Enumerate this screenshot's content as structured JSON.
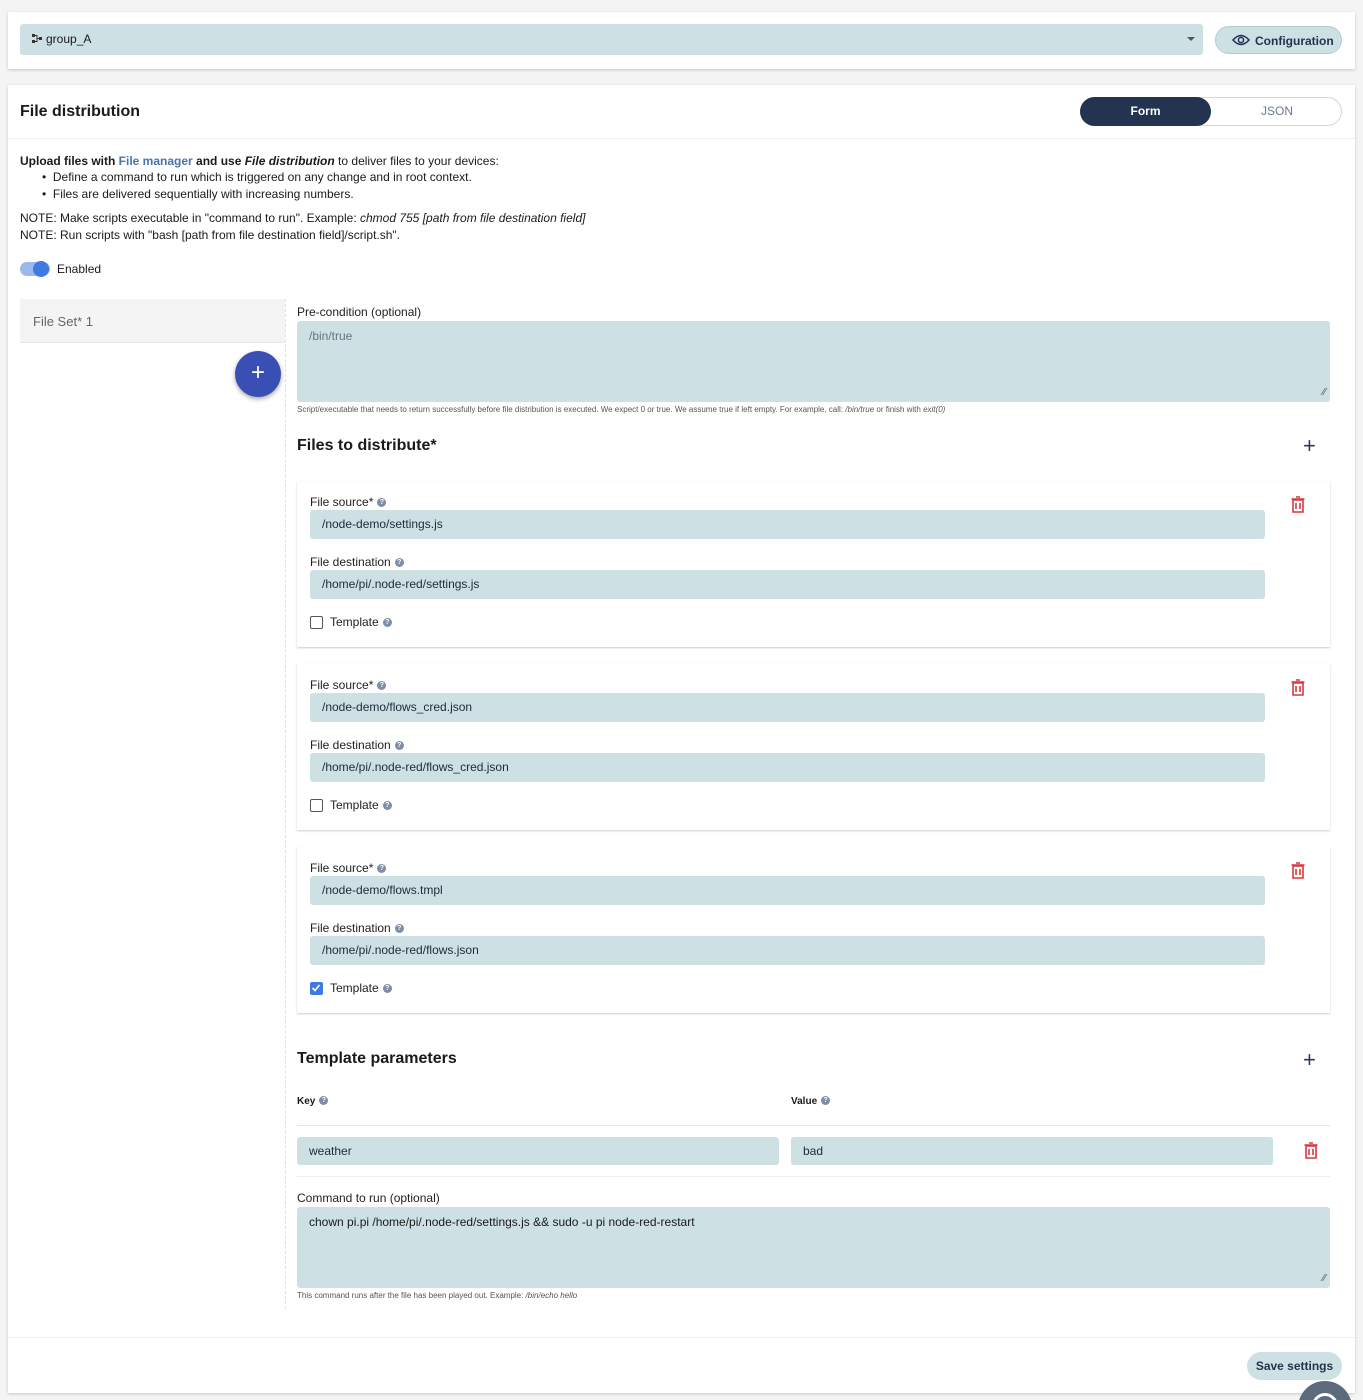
{
  "top": {
    "group_icon": "group-icon",
    "group_value": "group_A",
    "config_label": "Configuration"
  },
  "section": {
    "title": "File distribution",
    "tabs": [
      "Form",
      "JSON"
    ],
    "active_tab": "Form"
  },
  "intro": {
    "p1_a": "Upload files with ",
    "p1_link": "File manager",
    "p1_b": " and use ",
    "p1_c": "File distribution",
    "p1_d": " to deliver files to your devices:",
    "bullets": [
      "Define a command to run which is triggered on any change and in root context.",
      "Files are delivered sequentially with increasing numbers."
    ],
    "note1_a": "NOTE: Make scripts executable in \"command to run\". Example: ",
    "note1_b": "chmod 755 [path from file destination field]",
    "note2": "NOTE: Run scripts with \"bash [path from file destination field]/script.sh\".",
    "enabled_label": "Enabled"
  },
  "fileset": {
    "tab_label": "File Set* 1",
    "add_label": "+"
  },
  "precondition": {
    "label": "Pre-condition (optional)",
    "value": "/bin/true",
    "hint_a": "Script/executable that needs to return successfully before file distribution is executed. We expect 0 or true. We assume true if left empty. For example, call: ",
    "hint_b": "/bin/true",
    "hint_c": " or finish with ",
    "hint_d": "exit(0)"
  },
  "files": {
    "title": "Files to distribute*",
    "source_label": "File source*",
    "dest_label": "File destination",
    "template_label": "Template",
    "items": [
      {
        "source": "/node-demo/settings.js",
        "dest": "/home/pi/.node-red/settings.js",
        "template": false
      },
      {
        "source": "/node-demo/flows_cred.json",
        "dest": "/home/pi/.node-red/flows_cred.json",
        "template": false
      },
      {
        "source": "/node-demo/flows.tmpl",
        "dest": "/home/pi/.node-red/flows.json",
        "template": true
      }
    ]
  },
  "params": {
    "title": "Template parameters",
    "key_label": "Key",
    "value_label": "Value",
    "rows": [
      {
        "key": "weather",
        "value": "bad"
      }
    ]
  },
  "command": {
    "label": "Command to run (optional)",
    "value": "chown pi.pi /home/pi/.node-red/settings.js && sudo -u pi node-red-restart",
    "hint_a": "This command runs after the file has been played out. Example: ",
    "hint_b": "/bin/echo hello"
  },
  "footer": {
    "save_label": "Save settings"
  },
  "colors": {
    "field_bg": "#cde0e3",
    "dark_navy": "#22344f",
    "fab_blue": "#3a4fb4",
    "trash_red": "#d9363e",
    "link_blue": "#4a74a8"
  }
}
